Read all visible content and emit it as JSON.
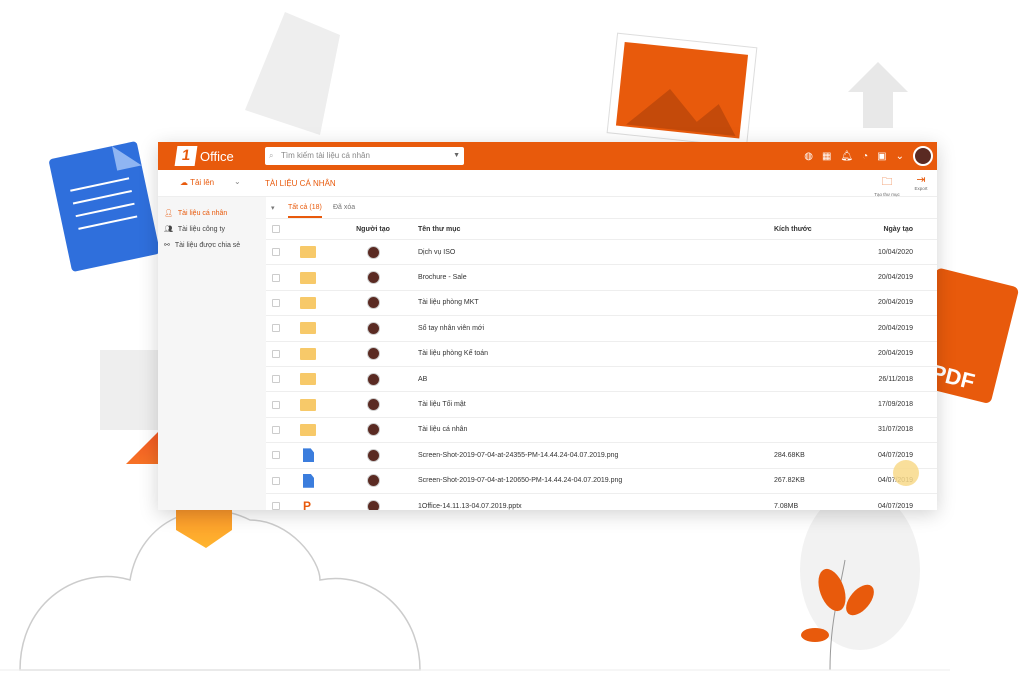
{
  "header": {
    "logo_text": "Office",
    "logo_mark": "1",
    "search_placeholder": "Tìm kiếm tài liệu cá nhân",
    "icons": [
      "globe-icon",
      "apps-icon",
      "bell-icon",
      "dashboard-icon",
      "help-icon",
      "chevron-down-icon",
      "avatar"
    ]
  },
  "toolbar": {
    "upload_label": "Tải lên",
    "breadcrumb": "TÀI LIỆU CÁ NHÂN",
    "new_folder_label": "Tạo thư mục",
    "export_label": "Export"
  },
  "sidebar": {
    "items": [
      {
        "label": "Tài liệu cá nhân",
        "active": true
      },
      {
        "label": "Tài liệu công ty"
      },
      {
        "label": "Tài liệu được chia sẻ"
      }
    ]
  },
  "tabs": {
    "all": "Tất cả (18)",
    "deleted": "Đã xóa"
  },
  "columns": {
    "creator": "Người tạo",
    "name": "Tên thư mục",
    "size": "Kích thước",
    "date": "Ngày tạo"
  },
  "rows": [
    {
      "type": "folder",
      "name": "Dịch vụ ISO",
      "size": "",
      "date": "10/04/2020"
    },
    {
      "type": "folder",
      "name": "Brochure - Sale",
      "size": "",
      "date": "20/04/2019"
    },
    {
      "type": "folder",
      "name": "Tài liệu phòng MKT",
      "size": "",
      "date": "20/04/2019"
    },
    {
      "type": "folder",
      "name": "Sổ tay nhân viên mới",
      "size": "",
      "date": "20/04/2019"
    },
    {
      "type": "folder",
      "name": "Tài liệu phòng Kế toán",
      "size": "",
      "date": "20/04/2019"
    },
    {
      "type": "folder",
      "name": "AB",
      "size": "",
      "date": "26/11/2018"
    },
    {
      "type": "folder",
      "name": "Tài liệu Tối mật",
      "size": "",
      "date": "17/09/2018"
    },
    {
      "type": "folder",
      "name": "Tài liệu cá nhân",
      "size": "",
      "date": "31/07/2018"
    },
    {
      "type": "image",
      "name": "Screen-Shot-2019-07-04-at-24355-PM-14.44.24-04.07.2019.png",
      "size": "284.68KB",
      "date": "04/07/2019"
    },
    {
      "type": "image",
      "name": "Screen-Shot-2019-07-04-at-120650-PM-14.44.24-04.07.2019.png",
      "size": "267.82KB",
      "date": "04/07/2019"
    },
    {
      "type": "pptx",
      "name": "1Office-14.11.13-04.07.2019.pptx",
      "size": "7.08MB",
      "date": "04/07/2019"
    }
  ],
  "colors": {
    "brand": "#e85a0c",
    "folder": "#f7c969"
  },
  "decor": {
    "pdf_fragment": "IF"
  }
}
